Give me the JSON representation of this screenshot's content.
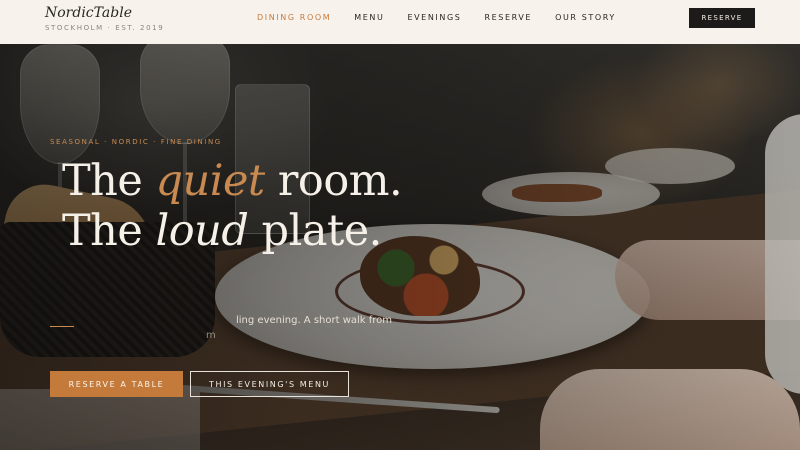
{
  "brand": {
    "name": "NordicTable",
    "sub": "STOCKHOLM · EST. 2019"
  },
  "nav": {
    "items": [
      {
        "label": "DINING ROOM",
        "active": true
      },
      {
        "label": "MENU",
        "active": false
      },
      {
        "label": "EVENINGS",
        "active": false
      },
      {
        "label": "RESERVE",
        "active": false
      },
      {
        "label": "OUR STORY",
        "active": false
      }
    ],
    "cta": "RESERVE"
  },
  "hero": {
    "eyebrow": "SEASONAL · NORDIC · FINE DINING",
    "line1_a": "The ",
    "line1_accent": "quiet",
    "line1_b": " room.",
    "line2_a": "The ",
    "line2_em": "loud",
    "line2_b": " plate.",
    "sub_line1": "ling evening. A short walk from",
    "sub_line2": "m",
    "primary_cta": "RESERVE A TABLE",
    "secondary_cta": "THIS EVENING'S MENU"
  },
  "colors": {
    "accent": "#c47a3b",
    "header_bg": "#f7f3ec",
    "dark_button": "#1d1b19",
    "headline": "#f6f1e8"
  }
}
